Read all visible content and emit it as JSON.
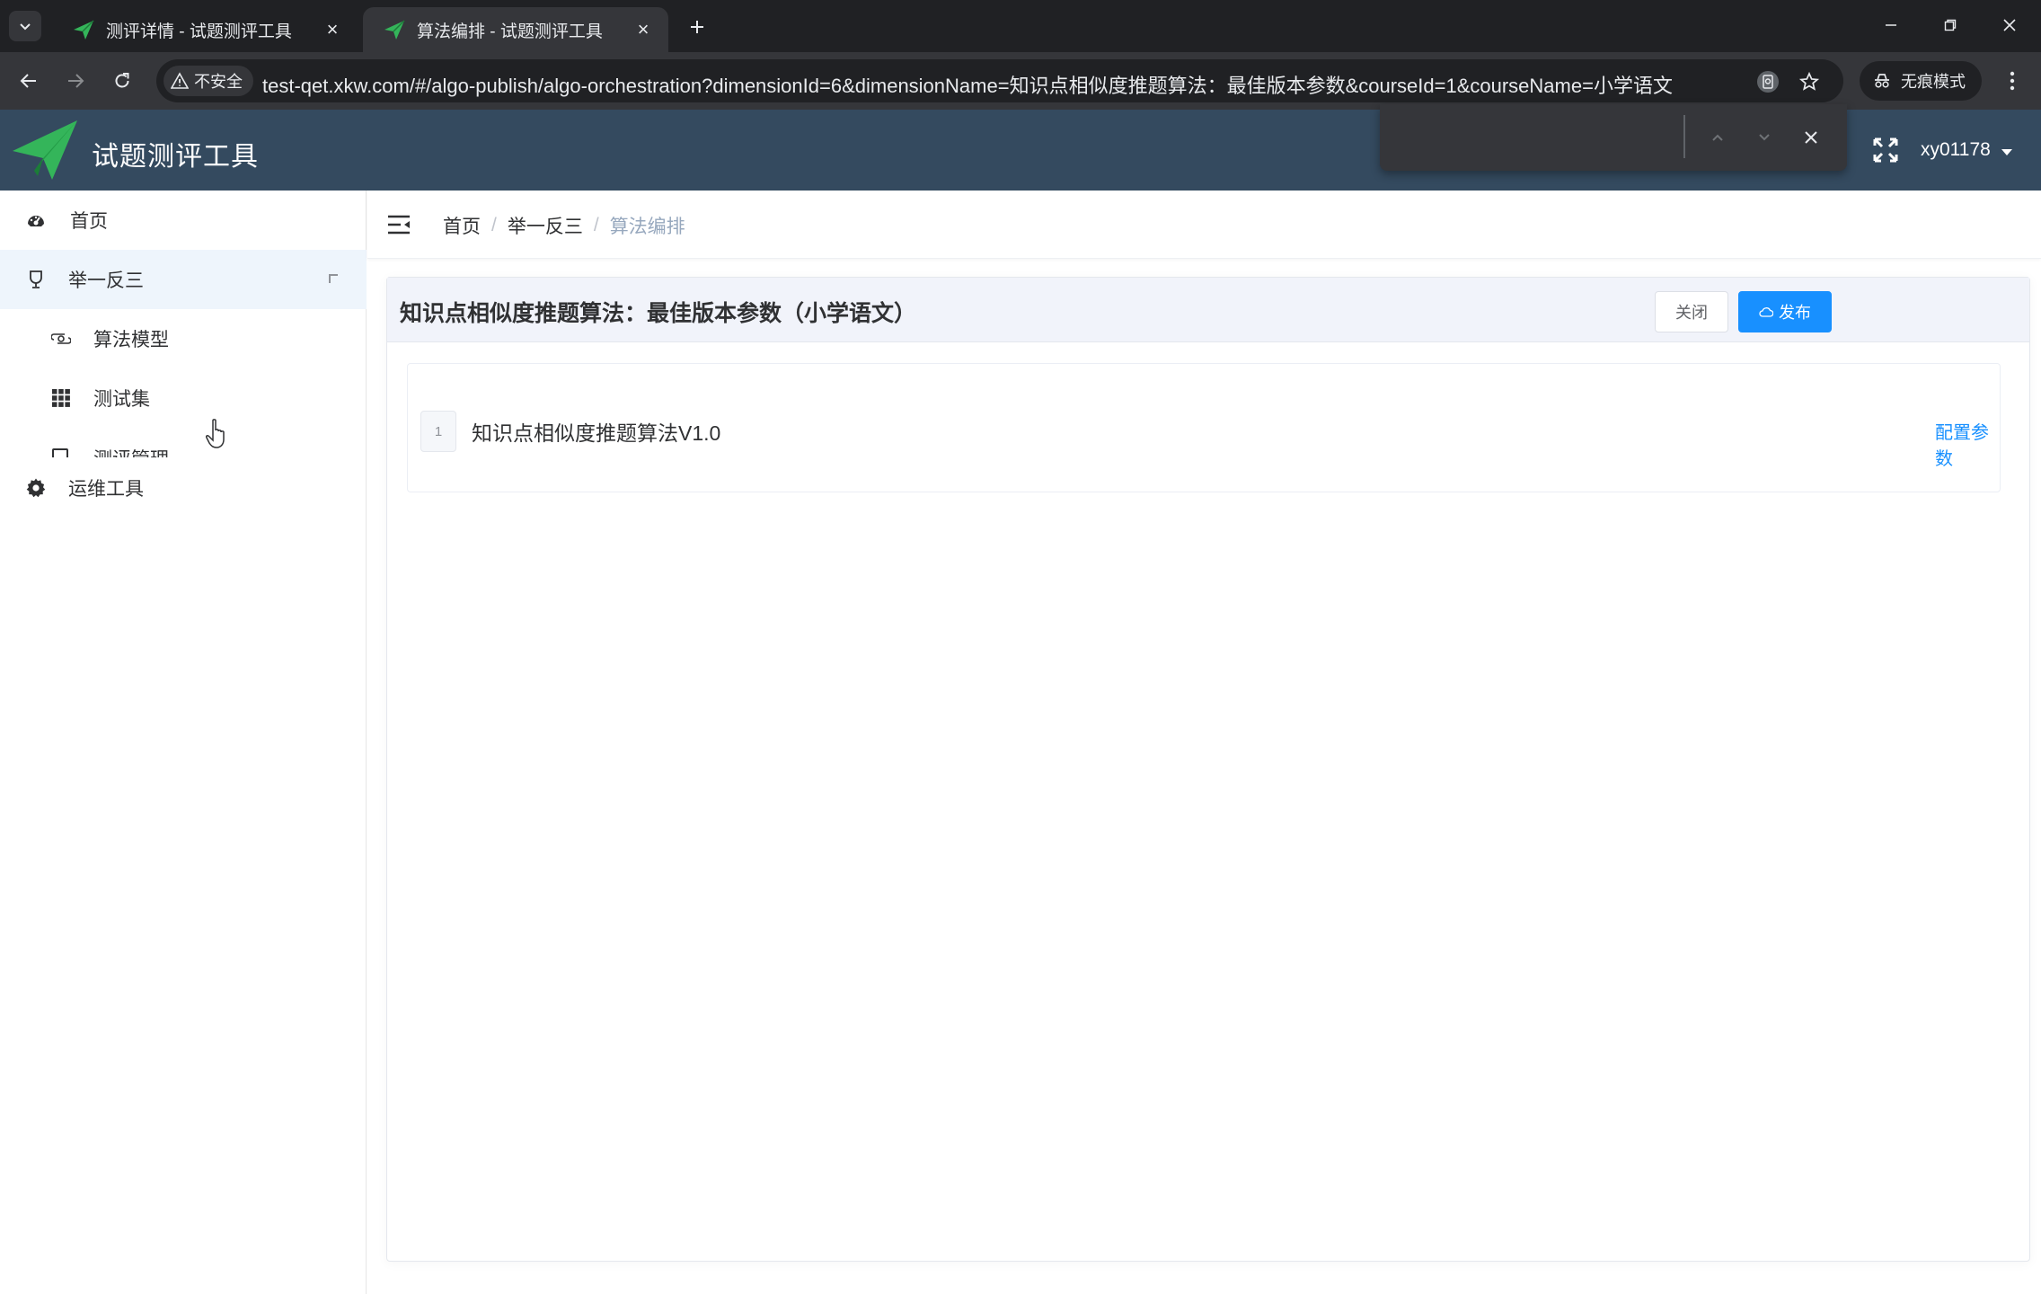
{
  "browser": {
    "tabs": [
      {
        "title": "测评详情 - 试题测评工具",
        "active": false
      },
      {
        "title": "算法编排 - 试题测评工具",
        "active": true
      }
    ],
    "security_label": "不安全",
    "url": "test-qet.xkw.com/#/algo-publish/algo-orchestration?dimensionId=6&dimensionName=知识点相似度推题算法：最佳版本参数&courseId=1&courseName=小学语文",
    "incognito_label": "无痕模式"
  },
  "header": {
    "app_title": "试题测评工具",
    "username": "xy01178"
  },
  "find_bar": {
    "query": ""
  },
  "sidebar": {
    "items": [
      {
        "label": "首页",
        "icon": "dashboard-icon"
      },
      {
        "label": "举一反三",
        "icon": "trophy-icon",
        "expanded": true,
        "children": [
          {
            "label": "算法模型",
            "icon": "model-icon"
          },
          {
            "label": "测试集",
            "icon": "grid-icon"
          },
          {
            "label": "测评管理",
            "icon": "list-icon",
            "clipped": true
          }
        ]
      },
      {
        "label": "运维工具",
        "icon": "gear-icon"
      }
    ]
  },
  "breadcrumb": [
    "首页",
    "举一反三",
    "算法编排"
  ],
  "panel": {
    "title": "知识点相似度推题算法：最佳版本参数（小学语文）",
    "close_label": "关闭",
    "publish_label": "发布"
  },
  "algorithms": [
    {
      "index": "1",
      "name": "知识点相似度推题算法V1.0",
      "action_label": "配置参数"
    }
  ],
  "colors": {
    "header_bg": "#344a5f",
    "accent": "#1890ff",
    "logo_green": "#34b55a",
    "active_menu_bg": "#eef5fc"
  }
}
